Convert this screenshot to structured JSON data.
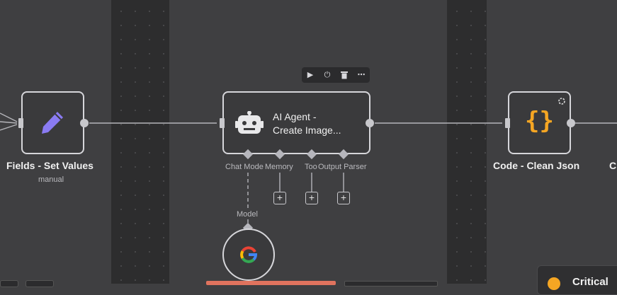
{
  "nodes": {
    "set_values": {
      "title": "Fields - Set Values",
      "subtitle": "manual",
      "icon": "pencil-icon"
    },
    "ai_agent": {
      "title_line1": "AI Agent -",
      "title_line2": "Create Image...",
      "icon": "robot-icon"
    },
    "code": {
      "title": "Code - Clean Json",
      "icon": "curly-braces-icon"
    },
    "next_partial": {
      "title": "C"
    },
    "gemini_model": {
      "icon": "google-g-icon"
    }
  },
  "agent_inputs": {
    "chat_model": "Chat Mode",
    "memory": "Memory",
    "tool": "Too",
    "output_parser": "Output Parser"
  },
  "model_label": "Model",
  "plus_label": "+",
  "toolbar": {
    "play": "▶",
    "power": "⏻",
    "delete": "🗑",
    "more": "⋯"
  },
  "notification": {
    "title_partial": "Critical "
  },
  "colors": {
    "canvas": "#3f3f41",
    "pencil": "#8a7bf2",
    "braces": "#f5a623",
    "error_bar": "#e0735e"
  }
}
